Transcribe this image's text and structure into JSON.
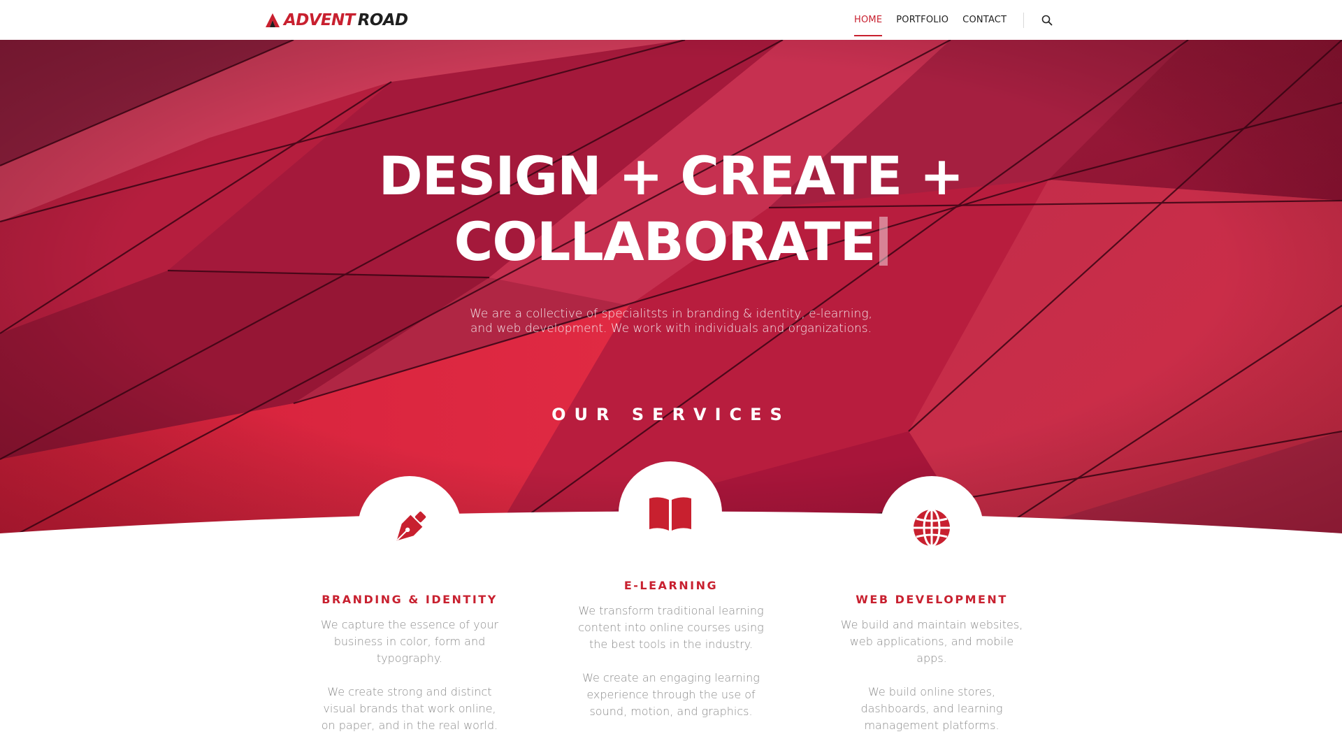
{
  "header": {
    "logo": {
      "word1": "ADVENT",
      "word2": "ROAD"
    },
    "nav": [
      {
        "label": "HOME",
        "active": true
      },
      {
        "label": "PORTFOLIO",
        "active": false
      },
      {
        "label": "CONTACT",
        "active": false
      }
    ],
    "search_icon": "search-icon"
  },
  "hero": {
    "title_line1": "DESIGN + CREATE +",
    "title_line2": "COLLABORATE",
    "subtitle_line1": "We are a collective of specialitsts in branding & identity, e-learning,",
    "subtitle_line2": "and web development. We work with individuals and organizations.",
    "services_heading": "OUR SERVICES"
  },
  "services": [
    {
      "icon": "pen-nib-icon",
      "title": "BRANDING & IDENTITY",
      "para1": "We capture the essence of your business in color, form and typography.",
      "para2": "We create strong and distinct visual brands that work online, on paper, and in the real world."
    },
    {
      "icon": "open-book-icon",
      "title": "E-LEARNING",
      "para1": "We transform traditional learning content into online courses using the best tools in the industry.",
      "para2": "We create an engaging learning experience through the use of sound, motion, and graphics."
    },
    {
      "icon": "globe-icon",
      "title": "WEB DEVELOPMENT",
      "para1": "We build and maintain websites, web applications, and mobile apps.",
      "para2": "We build online stores, dashboards, and learning management platforms."
    }
  ],
  "colors": {
    "accent": "#c8202f",
    "hero_base": "#b4233f",
    "text_muted": "#8b8b8b"
  }
}
